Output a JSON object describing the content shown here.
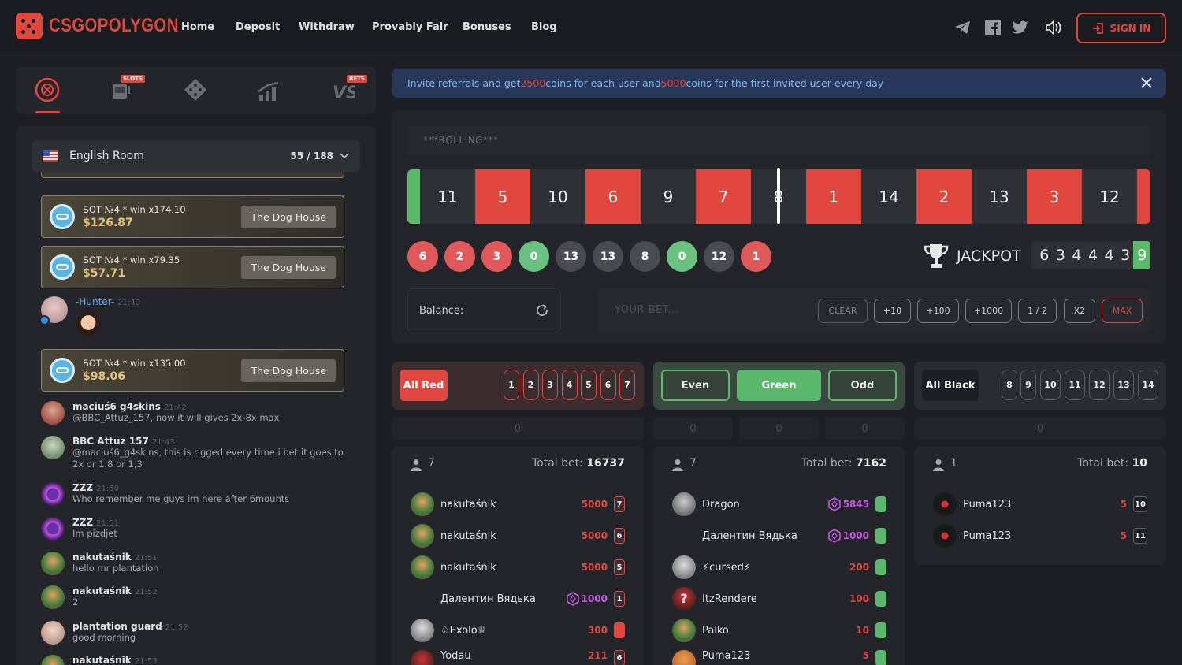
{
  "header": {
    "logo": "CSGOPOLYGON",
    "nav": [
      "Home",
      "Deposit",
      "Withdraw",
      "Provably Fair",
      "Bonuses",
      "Blog"
    ],
    "signin": "SIGN IN"
  },
  "game_tabs": {
    "slots_badge": "SLOTS",
    "bets_badge": "BETS"
  },
  "chat": {
    "room": "English Room",
    "online": "55 / 188",
    "wins": [
      {
        "line": "БОТ №4 * win x174.10",
        "amount": "$126.87",
        "game": "The Dog House"
      },
      {
        "line": "БОТ №4 * win x79.35",
        "amount": "$57.71",
        "game": "The Dog House"
      },
      {
        "line": "БОТ №4 * win x135.00",
        "amount": "$98.06",
        "game": "The Dog House"
      }
    ],
    "hunter": {
      "name": "-Hunter-",
      "time": "21:40"
    },
    "messages": [
      {
        "name": "maciuś6 g4skins",
        "time": "21:42",
        "text": "@BBC_Attuz_157, now it will gives 2x-8x max"
      },
      {
        "name": "BBC Attuz 157",
        "time": "21:43",
        "text": "@maciuś6_g4skins, this is rigged every time i bet it goes to 2x or 1.8 or 1,3"
      },
      {
        "name": "ZZZ",
        "time": "21:50",
        "text": "Who remember me guys im here after 6mounts"
      },
      {
        "name": "ZZZ",
        "time": "21:51",
        "text": "Im pizdjet"
      },
      {
        "name": "nakutaśnik",
        "time": "21:51",
        "text": "hello mr plantation"
      },
      {
        "name": "nakutaśnik",
        "time": "21:52",
        "text": "2"
      },
      {
        "name": "plantation guard",
        "time": "21:52",
        "text": "good morning"
      },
      {
        "name": "nakutaśnik",
        "time": "21:53",
        "text": ""
      }
    ]
  },
  "banner": {
    "pre": "Invite referrals and get ",
    "n1": "2500",
    "mid": " coins for each user and ",
    "n2": "5000",
    "post": " coins for the first invited user every day"
  },
  "roulette": {
    "status": "***ROLLING***",
    "strip": [
      {
        "n": "",
        "c": "g"
      },
      {
        "n": "11",
        "c": "b"
      },
      {
        "n": "5",
        "c": "r"
      },
      {
        "n": "10",
        "c": "b"
      },
      {
        "n": "6",
        "c": "r"
      },
      {
        "n": "9",
        "c": "b"
      },
      {
        "n": "7",
        "c": "r"
      },
      {
        "n": "8",
        "c": "b"
      },
      {
        "n": "1",
        "c": "r"
      },
      {
        "n": "14",
        "c": "b"
      },
      {
        "n": "2",
        "c": "r"
      },
      {
        "n": "13",
        "c": "b"
      },
      {
        "n": "3",
        "c": "r"
      },
      {
        "n": "12",
        "c": "b"
      },
      {
        "n": "",
        "c": "r"
      }
    ],
    "history": [
      {
        "n": "6",
        "c": "r"
      },
      {
        "n": "2",
        "c": "r"
      },
      {
        "n": "3",
        "c": "r"
      },
      {
        "n": "0",
        "c": "g"
      },
      {
        "n": "13",
        "c": "b"
      },
      {
        "n": "13",
        "c": "b"
      },
      {
        "n": "8",
        "c": "b"
      },
      {
        "n": "0",
        "c": "g"
      },
      {
        "n": "12",
        "c": "b"
      },
      {
        "n": "1",
        "c": "r"
      }
    ],
    "jackpot_label": "JACKPOT",
    "jackpot_digits": [
      "6",
      "3",
      "4",
      "4",
      "4",
      "3",
      "9"
    ]
  },
  "bet": {
    "balance_label": "Balance:",
    "placeholder": "YOUR BET...",
    "buttons": [
      "CLEAR",
      "+10",
      "+100",
      "+1000",
      "1 / 2",
      "X2",
      "MAX"
    ]
  },
  "sections": {
    "red": {
      "label": "All Red",
      "nums": [
        "1",
        "2",
        "3",
        "4",
        "5",
        "6",
        "7"
      ],
      "total": "0"
    },
    "green": {
      "labels": [
        "Even",
        "Green",
        "Odd"
      ],
      "totals": [
        "0",
        "0",
        "0"
      ]
    },
    "black": {
      "label": "All Black",
      "nums": [
        "8",
        "9",
        "10",
        "11",
        "12",
        "13",
        "14"
      ],
      "total": "0"
    }
  },
  "columns": [
    {
      "players": "7",
      "total_label": "Total bet:",
      "total": "16737",
      "rows": [
        {
          "name": "nakutaśnik",
          "amt": "5000",
          "chip": "7",
          "coin": false
        },
        {
          "name": "nakutaśnik",
          "amt": "5000",
          "chip": "6",
          "coin": false
        },
        {
          "name": "nakutaśnik",
          "amt": "5000",
          "chip": "5",
          "coin": false
        },
        {
          "name": "Далентин Вядька",
          "amt": "1000",
          "chip": "1",
          "coin": true
        },
        {
          "name": "♤Exolo♕",
          "amt": "300",
          "chip": "",
          "coin": false
        },
        {
          "name": "Yodau",
          "amt": "211",
          "chip": "6",
          "coin": false
        }
      ]
    },
    {
      "players": "7",
      "total_label": "Total bet:",
      "total": "7162",
      "rows": [
        {
          "name": "Dragon",
          "amt": "5845",
          "chip": "",
          "coin": true
        },
        {
          "name": "Далентин Вядька",
          "amt": "1000",
          "chip": "",
          "coin": true
        },
        {
          "name": "⚡cursed⚡",
          "amt": "200",
          "chip": "",
          "coin": false
        },
        {
          "name": "ItzRendere",
          "amt": "100",
          "chip": "",
          "coin": false
        },
        {
          "name": "Palko",
          "amt": "10",
          "chip": "",
          "coin": false
        },
        {
          "name": "Puma123",
          "amt": "5",
          "chip": "",
          "coin": false
        }
      ]
    },
    {
      "players": "1",
      "total_label": "Total bet:",
      "total": "10",
      "rows": [
        {
          "name": "Puma123",
          "amt": "5",
          "chip": "10",
          "coin": false
        },
        {
          "name": "Puma123",
          "amt": "5",
          "chip": "11",
          "coin": false
        }
      ]
    }
  ],
  "colors": {
    "accent": "#e0473e",
    "green": "#5bb96c",
    "bg": "#1d1f24",
    "panel": "#23252a",
    "banner": "#27385a",
    "link": "#7fb7ea"
  }
}
